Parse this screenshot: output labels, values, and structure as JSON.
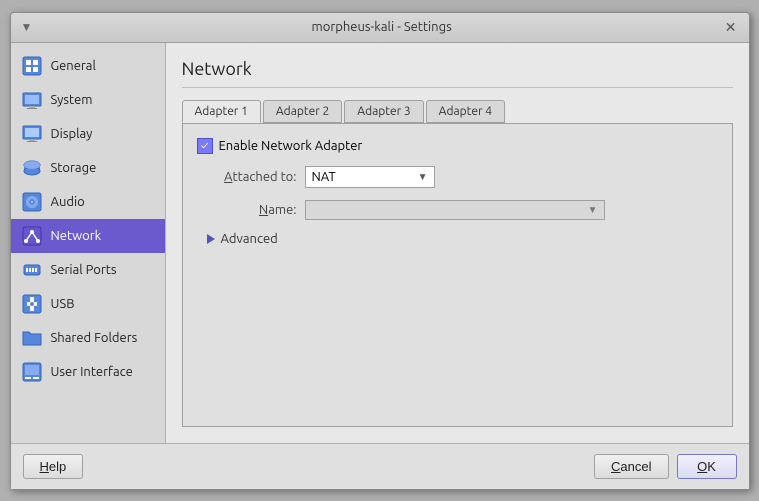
{
  "window": {
    "title": "morpheus-kali - Settings",
    "close_label": "✕"
  },
  "sidebar": {
    "items": [
      {
        "id": "general",
        "label": "General",
        "icon": "⚙"
      },
      {
        "id": "system",
        "label": "System",
        "icon": "🖥"
      },
      {
        "id": "display",
        "label": "Display",
        "icon": "🖵"
      },
      {
        "id": "storage",
        "label": "Storage",
        "icon": "💾"
      },
      {
        "id": "audio",
        "label": "Audio",
        "icon": "🔊"
      },
      {
        "id": "network",
        "label": "Network",
        "icon": "🌐"
      },
      {
        "id": "serial-ports",
        "label": "Serial Ports",
        "icon": "⬡"
      },
      {
        "id": "usb",
        "label": "USB",
        "icon": "⛽"
      },
      {
        "id": "shared-folders",
        "label": "Shared Folders",
        "icon": "📁"
      },
      {
        "id": "user-interface",
        "label": "User Interface",
        "icon": "🖱"
      }
    ]
  },
  "main": {
    "panel_title": "Network",
    "tabs": [
      {
        "id": "adapter1",
        "label": "Adapter 1",
        "underline": "1"
      },
      {
        "id": "adapter2",
        "label": "Adapter 2",
        "underline": "2"
      },
      {
        "id": "adapter3",
        "label": "Adapter 3",
        "underline": "3"
      },
      {
        "id": "adapter4",
        "label": "Adapter 4",
        "underline": "4"
      }
    ],
    "enable_label": "Enable Network Adapter",
    "attached_label": "Attached to:",
    "attached_value": "NAT",
    "name_label": "Name:",
    "name_value": "",
    "advanced_label": "Advanced"
  },
  "footer": {
    "help_label": "Help",
    "cancel_label": "Cancel",
    "ok_label": "OK"
  }
}
